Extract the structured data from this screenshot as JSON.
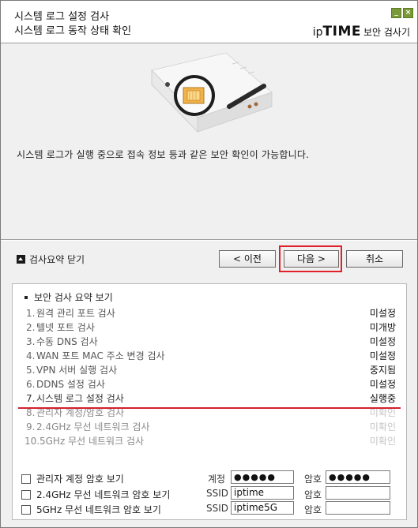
{
  "window": {
    "title_line1": "시스템 로그 설정 검사",
    "title_line2": "시스템 로그 동작 상태 확인",
    "brand_ip": "ip",
    "brand_time": "TIME",
    "brand_sub": "보안 검사기",
    "minimize_glyph": "_",
    "close_glyph": "×"
  },
  "description": "시스템 로그가 실행 중으로 접속 정보 등과 같은 보안 확인이 가능합니다.",
  "controls": {
    "toggle_summary_label": "검사요약 닫기",
    "prev_label": "< 이전",
    "next_label": "다음 >",
    "cancel_label": "취소"
  },
  "summary": {
    "title": "보안 검사 요약 보기",
    "items": [
      {
        "num": "1.",
        "label": "원격 관리 포트 검사",
        "status": "미설정"
      },
      {
        "num": "2.",
        "label": "텔넷 포트 검사",
        "status": "미개방"
      },
      {
        "num": "3.",
        "label": "수동 DNS 검사",
        "status": "미설정"
      },
      {
        "num": "4.",
        "label": "WAN 포트 MAC 주소 변경 검사",
        "status": "미설정"
      },
      {
        "num": "5.",
        "label": "VPN 서버 실행 검사",
        "status": "중지됨"
      },
      {
        "num": "6.",
        "label": "DDNS 설정 검사",
        "status": "미설정"
      },
      {
        "num": "7.",
        "label": "시스템 로그 설정 검사",
        "status": "실행중"
      },
      {
        "num": "8.",
        "label": "관리자 계정/암호 검사",
        "status": "미확인"
      },
      {
        "num": "9.",
        "label": "2.4GHz 무선 네트워크 검사",
        "status": "미확인"
      },
      {
        "num": "10.",
        "label": "5GHz 무선 네트워크 검사",
        "status": "미확인"
      }
    ],
    "options": {
      "admin_show_label": "관리자 계정 암호 보기",
      "wifi24_show_label": "2.4GHz 무선 네트워크 암호 보기",
      "wifi5_show_label": "5GHz 무선 네트워크 암호 보기"
    },
    "fields": {
      "account_label": "계정",
      "account_value": "●●●●●",
      "password_label": "암호",
      "admin_password_value": "●●●●●",
      "ssid_label": "SSID",
      "ssid24_value": "iptime",
      "ssid5_value": "iptime5G",
      "wifi24_password_value": "",
      "wifi5_password_value": ""
    }
  },
  "colors": {
    "highlight": "#e0202a",
    "underline": "#d4202c",
    "window_icons": "#7a9a3a"
  }
}
